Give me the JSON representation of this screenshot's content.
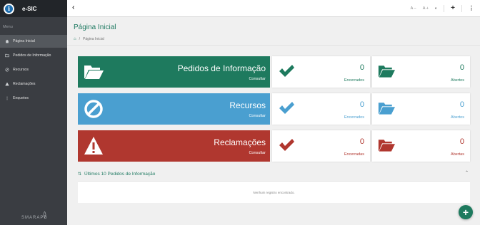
{
  "app": {
    "name": "e-SIC"
  },
  "sidebar": {
    "menu_label": "Menu",
    "items": [
      {
        "label": "Página Inicial",
        "icon": "home-icon",
        "active": true
      },
      {
        "label": "Pedidos de Informação",
        "icon": "folder-icon",
        "active": false
      },
      {
        "label": "Recursos",
        "icon": "ban-icon",
        "active": false
      },
      {
        "label": "Reclamações",
        "icon": "warning-icon",
        "active": false
      },
      {
        "label": "Enquetes",
        "icon": "list-icon",
        "active": false
      }
    ],
    "brand": "SMARAPD"
  },
  "topbar": {
    "font_decrease": "A −",
    "font_increase": "A +",
    "contrast": "◐",
    "add": "+",
    "more": "⋮"
  },
  "page": {
    "title": "Página Inicial",
    "breadcrumb": [
      "Página Inicial"
    ]
  },
  "rows": [
    {
      "title": "Pedidos de Informação",
      "action": "Consultar",
      "color": "#1e7a5e",
      "closed": {
        "count": "0",
        "label": "Encerrados"
      },
      "open": {
        "count": "0",
        "label": "Abertos"
      }
    },
    {
      "title": "Recursos",
      "action": "Consultar",
      "color": "#4a9fd0",
      "closed": {
        "count": "0",
        "label": "Encerrados"
      },
      "open": {
        "count": "0",
        "label": "Abertos"
      }
    },
    {
      "title": "Reclamações",
      "action": "Consultar",
      "color": "#b0372f",
      "closed": {
        "count": "0",
        "label": "Encerradas"
      },
      "open": {
        "count": "0",
        "label": "Abertas"
      }
    }
  ],
  "panel": {
    "title": "Últimos 10 Pedidos de Informação",
    "empty_text": "Nenhum registro encontrado."
  },
  "fab": {
    "label": "+"
  }
}
